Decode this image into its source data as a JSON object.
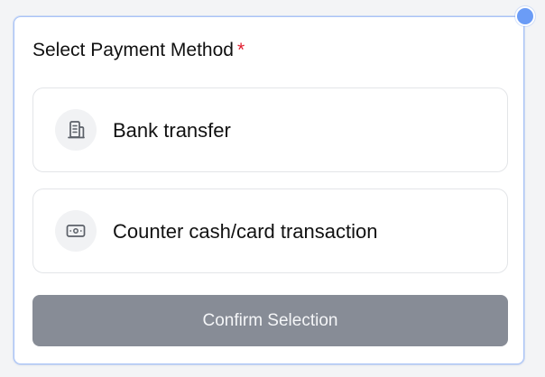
{
  "form": {
    "title": "Select Payment Method",
    "required_marker": "*",
    "options": [
      {
        "label": "Bank transfer",
        "icon": "bank-icon"
      },
      {
        "label": "Counter cash/card transaction",
        "icon": "cash-icon"
      }
    ],
    "confirm_label": "Confirm Selection",
    "confirm_disabled": true
  },
  "colors": {
    "required": "#e11d2e",
    "button_disabled_bg": "#878c96",
    "focus_border": "#a9c3f7",
    "handle_dot": "#6b9cf6"
  }
}
